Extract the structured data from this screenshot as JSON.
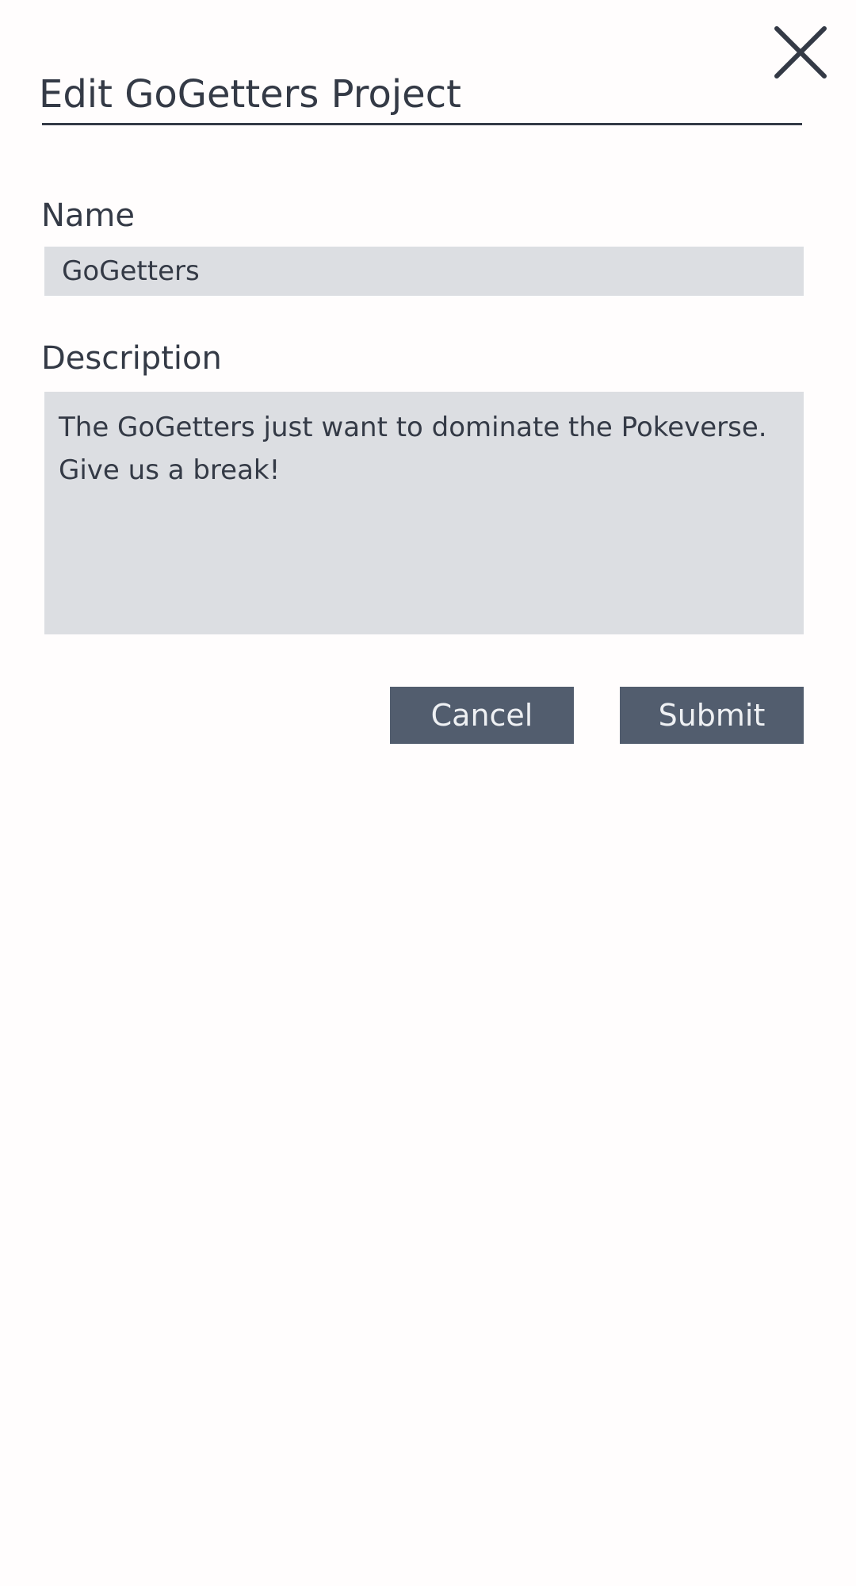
{
  "dialog": {
    "title": "Edit GoGetters Project",
    "close_icon": "close-icon"
  },
  "form": {
    "name_label": "Name",
    "name_value": "GoGetters",
    "description_label": "Description",
    "description_value": "The GoGetters just want to dominate the Pokeverse.\nGive us a break!"
  },
  "actions": {
    "cancel_label": "Cancel",
    "submit_label": "Submit"
  },
  "colors": {
    "text": "#343a46",
    "field_background": "#dcdee2",
    "button_background": "#525d6e",
    "button_text": "#eef0f3",
    "page_background": "#fffdfd"
  }
}
